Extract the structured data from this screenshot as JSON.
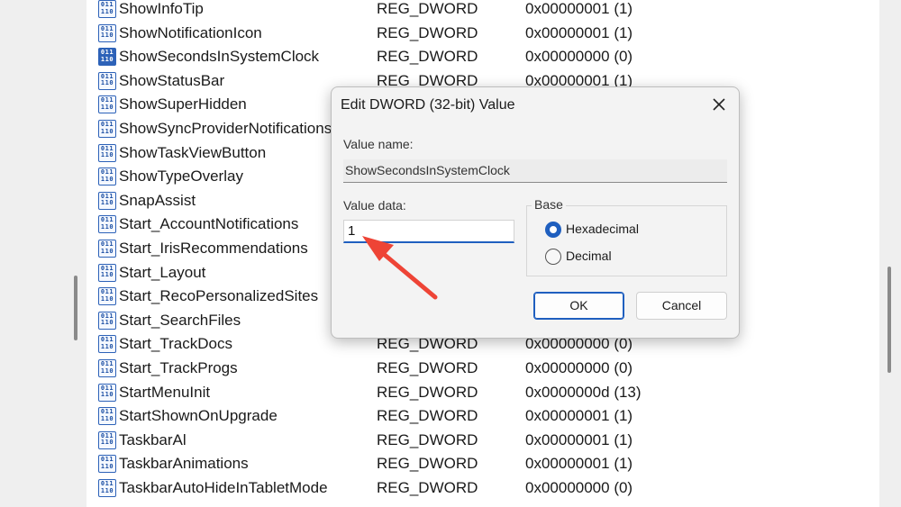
{
  "registry_values": [
    {
      "name": "ShowInfoTip",
      "type": "REG_DWORD",
      "data": "0x00000001 (1)"
    },
    {
      "name": "ShowNotificationIcon",
      "type": "REG_DWORD",
      "data": "0x00000001 (1)"
    },
    {
      "name": "ShowSecondsInSystemClock",
      "type": "REG_DWORD",
      "data": "0x00000000 (0)",
      "selected": true
    },
    {
      "name": "ShowStatusBar",
      "type": "REG_DWORD",
      "data": "0x00000001 (1)"
    },
    {
      "name": "ShowSuperHidden",
      "type": "",
      "data": ""
    },
    {
      "name": "ShowSyncProviderNotifications",
      "type": "",
      "data": ""
    },
    {
      "name": "ShowTaskViewButton",
      "type": "",
      "data": ""
    },
    {
      "name": "ShowTypeOverlay",
      "type": "",
      "data": ""
    },
    {
      "name": "SnapAssist",
      "type": "",
      "data": ""
    },
    {
      "name": "Start_AccountNotifications",
      "type": "",
      "data": ""
    },
    {
      "name": "Start_IrisRecommendations",
      "type": "",
      "data": ""
    },
    {
      "name": "Start_Layout",
      "type": "",
      "data": ""
    },
    {
      "name": "Start_RecoPersonalizedSites",
      "type": "",
      "data": ""
    },
    {
      "name": "Start_SearchFiles",
      "type": "",
      "data": ""
    },
    {
      "name": "Start_TrackDocs",
      "type": "REG_DWORD",
      "data": "0x00000000 (0)"
    },
    {
      "name": "Start_TrackProgs",
      "type": "REG_DWORD",
      "data": "0x00000000 (0)"
    },
    {
      "name": "StartMenuInit",
      "type": "REG_DWORD",
      "data": "0x0000000d (13)"
    },
    {
      "name": "StartShownOnUpgrade",
      "type": "REG_DWORD",
      "data": "0x00000001 (1)"
    },
    {
      "name": "TaskbarAl",
      "type": "REG_DWORD",
      "data": "0x00000001 (1)"
    },
    {
      "name": "TaskbarAnimations",
      "type": "REG_DWORD",
      "data": "0x00000001 (1)"
    },
    {
      "name": "TaskbarAutoHideInTabletMode",
      "type": "REG_DWORD",
      "data": "0x00000000 (0)"
    }
  ],
  "registry_icon": {
    "top": "011",
    "bottom": "110",
    "icon_name": "reg-dword-icon"
  },
  "dialog": {
    "title": "Edit DWORD (32-bit) Value",
    "value_name_label": "Value name:",
    "value_name": "ShowSecondsInSystemClock",
    "value_data_label": "Value data:",
    "value_data": "1",
    "base_label": "Base",
    "base_options": [
      {
        "label": "Hexadecimal",
        "selected": true
      },
      {
        "label": "Decimal",
        "selected": false
      }
    ],
    "ok_label": "OK",
    "cancel_label": "Cancel"
  },
  "colors": {
    "accent": "#1f5fbf",
    "arrow": "#ee4436",
    "icon_blue": "#2d62b8"
  }
}
